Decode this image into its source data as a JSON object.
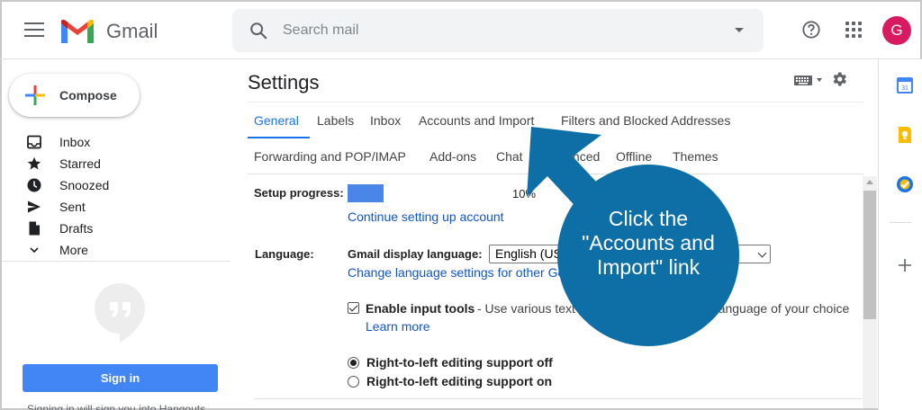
{
  "app": {
    "name": "Gmail"
  },
  "search": {
    "placeholder": "Search mail"
  },
  "user": {
    "initial": "G",
    "avatar_color": "#d81b60"
  },
  "compose": {
    "label": "Compose"
  },
  "sidebar": {
    "items": [
      {
        "label": "Inbox",
        "icon": "inbox-icon"
      },
      {
        "label": "Starred",
        "icon": "star-icon"
      },
      {
        "label": "Snoozed",
        "icon": "clock-icon"
      },
      {
        "label": "Sent",
        "icon": "send-icon"
      },
      {
        "label": "Drafts",
        "icon": "draft-icon"
      },
      {
        "label": "More",
        "icon": "chevron-down-icon"
      }
    ]
  },
  "hangouts": {
    "signin_label": "Sign in",
    "note": "Signing in will sign you into Hangouts"
  },
  "settings": {
    "title": "Settings",
    "tabs_row1": [
      "General",
      "Labels",
      "Inbox",
      "Accounts and Import",
      "Filters and Blocked Addresses"
    ],
    "tabs_row2": [
      "Forwarding and POP/IMAP",
      "Add-ons",
      "Chat",
      "Advanced",
      "Offline",
      "Themes"
    ],
    "active_tab": "General",
    "setup": {
      "label": "Setup progress:",
      "percent_text": "10%",
      "progress": 0.19,
      "link": "Continue setting up account"
    },
    "language": {
      "label": "Language:",
      "display_label": "Gmail display language:",
      "selected": "English (US)",
      "change_link": "Change language settings for other Google products",
      "input_tools_label": "Enable input tools",
      "input_tools_desc": "- Use various text input tools to type in the language of your choice",
      "learn_more": "Learn more",
      "rtl_off": "Right-to-left editing support off",
      "rtl_on": "Right-to-left editing support on"
    }
  },
  "callout": {
    "text": "Click the \"Accounts and Import\" link",
    "color": "#0e6fa6"
  },
  "colors": {
    "accent": "#1a73e8",
    "link": "#1155cc",
    "progress": "#4a86e8"
  }
}
